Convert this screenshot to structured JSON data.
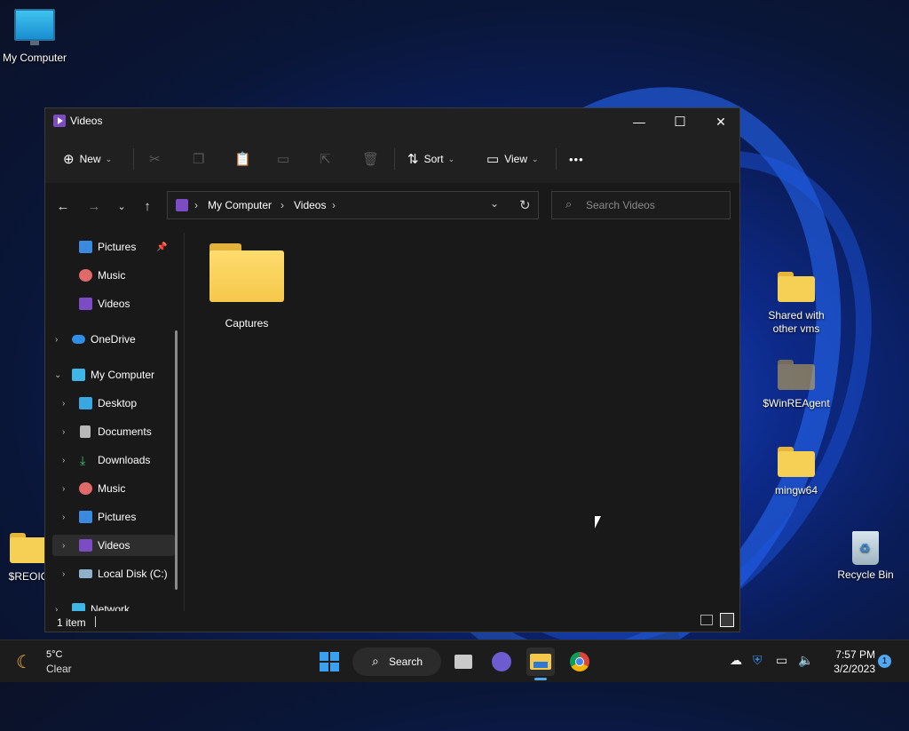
{
  "desktop": {
    "icons": [
      {
        "label": "My Computer"
      },
      {
        "label": "Shared with other vms"
      },
      {
        "label": "$WinREAgent"
      },
      {
        "label": "mingw64"
      },
      {
        "label": "Recycle Bin"
      },
      {
        "label": "$REOIC"
      }
    ]
  },
  "window": {
    "title": "Videos",
    "controls": {
      "minimize": "—",
      "maximize": "☐",
      "close": "✕"
    },
    "toolbar": {
      "new_label": "New",
      "sort_label": "Sort",
      "view_label": "View",
      "more_label": "•••"
    },
    "address": {
      "crumbs": [
        "My Computer",
        "Videos"
      ],
      "separator": "›"
    },
    "search": {
      "placeholder": "Search Videos"
    },
    "nav_pane": {
      "items": [
        {
          "label": "Pictures"
        },
        {
          "label": "Music"
        },
        {
          "label": "Videos"
        },
        {
          "label": "OneDrive"
        },
        {
          "label": "My Computer"
        },
        {
          "label": "Desktop"
        },
        {
          "label": "Documents"
        },
        {
          "label": "Downloads"
        },
        {
          "label": "Music"
        },
        {
          "label": "Pictures"
        },
        {
          "label": "Videos"
        },
        {
          "label": "Local Disk (C:)"
        },
        {
          "label": "Network"
        }
      ]
    },
    "content": {
      "items": [
        {
          "label": "Captures",
          "type": "folder"
        }
      ]
    },
    "status": {
      "count": "1 item"
    }
  },
  "taskbar": {
    "weather": {
      "temp": "5°C",
      "condition": "Clear"
    },
    "search_label": "Search",
    "clock": {
      "time": "7:57 PM",
      "date": "3/2/2023"
    },
    "notification_count": "1"
  },
  "colors": {
    "accent": "#0078d4",
    "folder": "#f4c84a",
    "video_purple": "#7b4cc4"
  }
}
